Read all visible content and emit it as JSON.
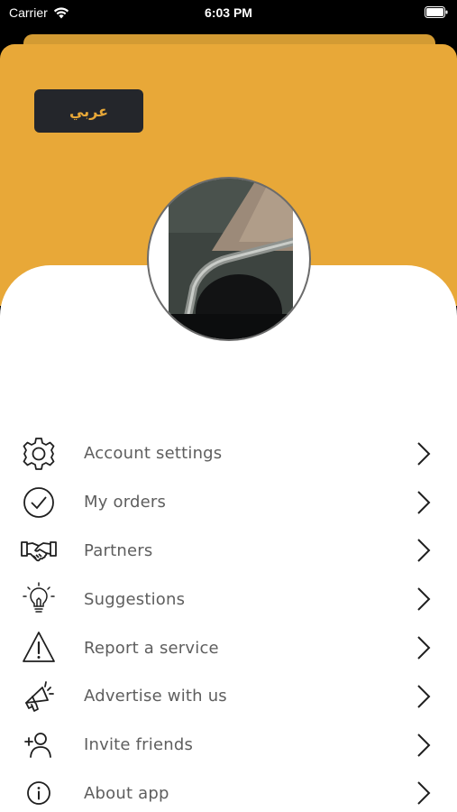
{
  "status_bar": {
    "carrier": "Carrier",
    "time": "6:03 PM"
  },
  "header": {
    "language_button_label": "عربي"
  },
  "colors": {
    "accent": "#e8a838",
    "header_tab": "#d39b33",
    "dark_button": "#24262b",
    "label_text": "#5e5e5e",
    "icon": "#1f1f1f"
  },
  "menu": {
    "items": [
      {
        "label": "Account settings",
        "icon": "gear-icon"
      },
      {
        "label": "My orders",
        "icon": "check-circle-icon"
      },
      {
        "label": "Partners",
        "icon": "handshake-icon"
      },
      {
        "label": "Suggestions",
        "icon": "lightbulb-icon"
      },
      {
        "label": "Report a service",
        "icon": "warning-icon"
      },
      {
        "label": "Advertise with us",
        "icon": "megaphone-icon"
      },
      {
        "label": "Invite friends",
        "icon": "add-user-icon"
      },
      {
        "label": "About app",
        "icon": "info-icon"
      }
    ]
  }
}
